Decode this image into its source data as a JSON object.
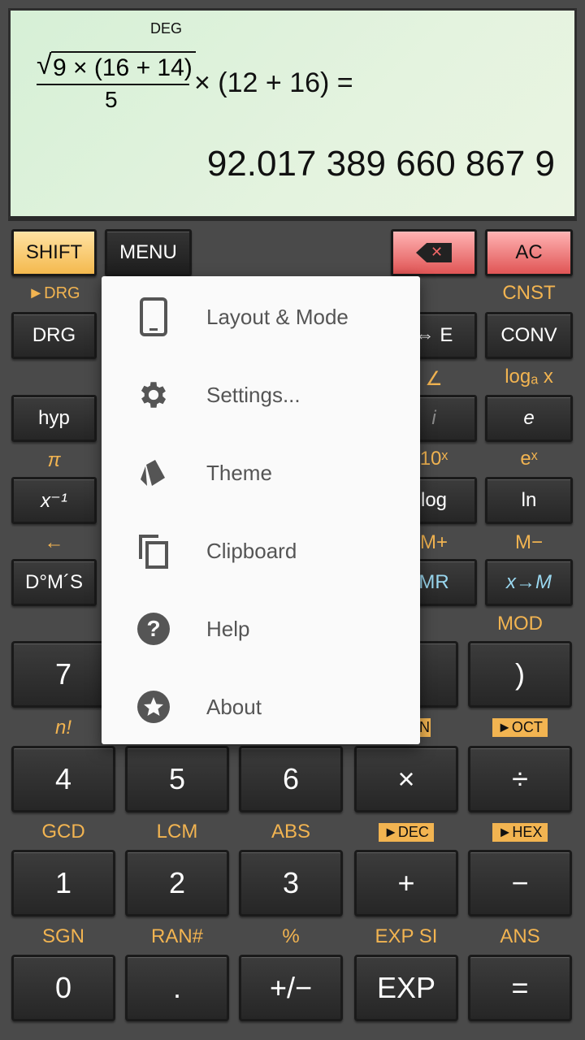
{
  "display": {
    "angle_mode": "DEG",
    "radicand": "9 × (16 + 14)",
    "denominator": "5",
    "expression_rest": "× (12 + 16) =",
    "result": "92.017 389 660 867 9"
  },
  "top_row": {
    "shift": "SHIFT",
    "menu": "MENU",
    "ac": "AC"
  },
  "labels": {
    "drg_shift": "►DRG",
    "cnst": "CNST",
    "angle": "∠",
    "loga": "logₐ x",
    "pi": "π",
    "ten_x": "10ˣ",
    "e_x": "eˣ",
    "arrow_left": "←",
    "m_plus": "M+",
    "m_minus": "M−",
    "mod": "MOD",
    "n_fact": "n!",
    "bin_partial": "N",
    "oct": "►OCT",
    "gcd": "GCD",
    "lcm": "LCM",
    "abs": "ABS",
    "dec": "►DEC",
    "hex": "►HEX",
    "sgn": "SGN",
    "ran": "RAN#",
    "percent": "%",
    "exp_si": "EXP SI",
    "ans": "ANS"
  },
  "keys": {
    "drg": "DRG",
    "arrow_e": "⇔ E",
    "conv": "CONV",
    "hyp": "hyp",
    "i": "i",
    "e": "e",
    "x_inv": "x⁻¹",
    "log": "log",
    "ln": "ln",
    "dms": "D°M´S",
    "mr": "MR",
    "x_to_m": "x→M",
    "seven": "7",
    "close_paren": ")",
    "four": "4",
    "five": "5",
    "six": "6",
    "times": "×",
    "divide": "÷",
    "one": "1",
    "two": "2",
    "three": "3",
    "plus": "+",
    "minus": "−",
    "zero": "0",
    "dot": ".",
    "plusminus": "+/−",
    "exp": "EXP",
    "equals": "="
  },
  "menu_popup": {
    "items": [
      {
        "label": "Layout & Mode",
        "icon": "tablet-icon"
      },
      {
        "label": "Settings...",
        "icon": "gear-icon"
      },
      {
        "label": "Theme",
        "icon": "palette-cards-icon"
      },
      {
        "label": "Clipboard",
        "icon": "copy-icon"
      },
      {
        "label": "Help",
        "icon": "help-circle-icon"
      },
      {
        "label": "About",
        "icon": "star-circle-icon"
      }
    ]
  },
  "colors": {
    "shift_label": "#f2b451",
    "display_bg": "#d6f0d6",
    "memory_blue": "#9ad8f0",
    "ac_red": "#e05555"
  }
}
